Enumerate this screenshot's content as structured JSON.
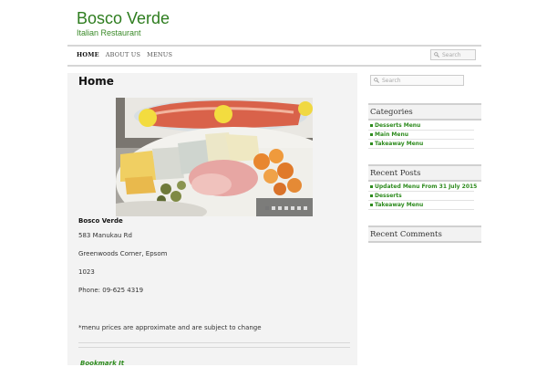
{
  "header": {
    "site_title": "Bosco Verde",
    "tagline": "Italian Restaurant"
  },
  "nav": {
    "items": [
      {
        "label": "HOME",
        "active": true
      },
      {
        "label": "ABOUT US",
        "active": false
      },
      {
        "label": "MENUS",
        "active": false
      }
    ],
    "search_placeholder": "Search"
  },
  "main": {
    "page_title": "Home",
    "slider": {
      "slide_count": 7,
      "active_slide": 1
    },
    "content": {
      "name": "Bosco Verde",
      "address1": "583 Manukau Rd",
      "address2": "Greenwoods Corner, Epsom",
      "postcode": "1023",
      "phone": "Phone: 09-625 4319",
      "note": "*menu prices are approximate and are subject to change"
    },
    "bookmark_label": "Bookmark It"
  },
  "sidebar": {
    "search_placeholder": "Search",
    "categories": {
      "title": "Categories",
      "items": [
        "Desserts Menu",
        "Main Menu",
        "Takeaway Menu"
      ]
    },
    "recent_posts": {
      "title": "Recent Posts",
      "items": [
        "Updated Menu From 31 July 2015",
        "Desserts",
        "Takeaway Menu"
      ]
    },
    "recent_comments": {
      "title": "Recent Comments"
    }
  },
  "colors": {
    "accent": "#2e8b1e",
    "title_green": "#2e7d1f"
  }
}
